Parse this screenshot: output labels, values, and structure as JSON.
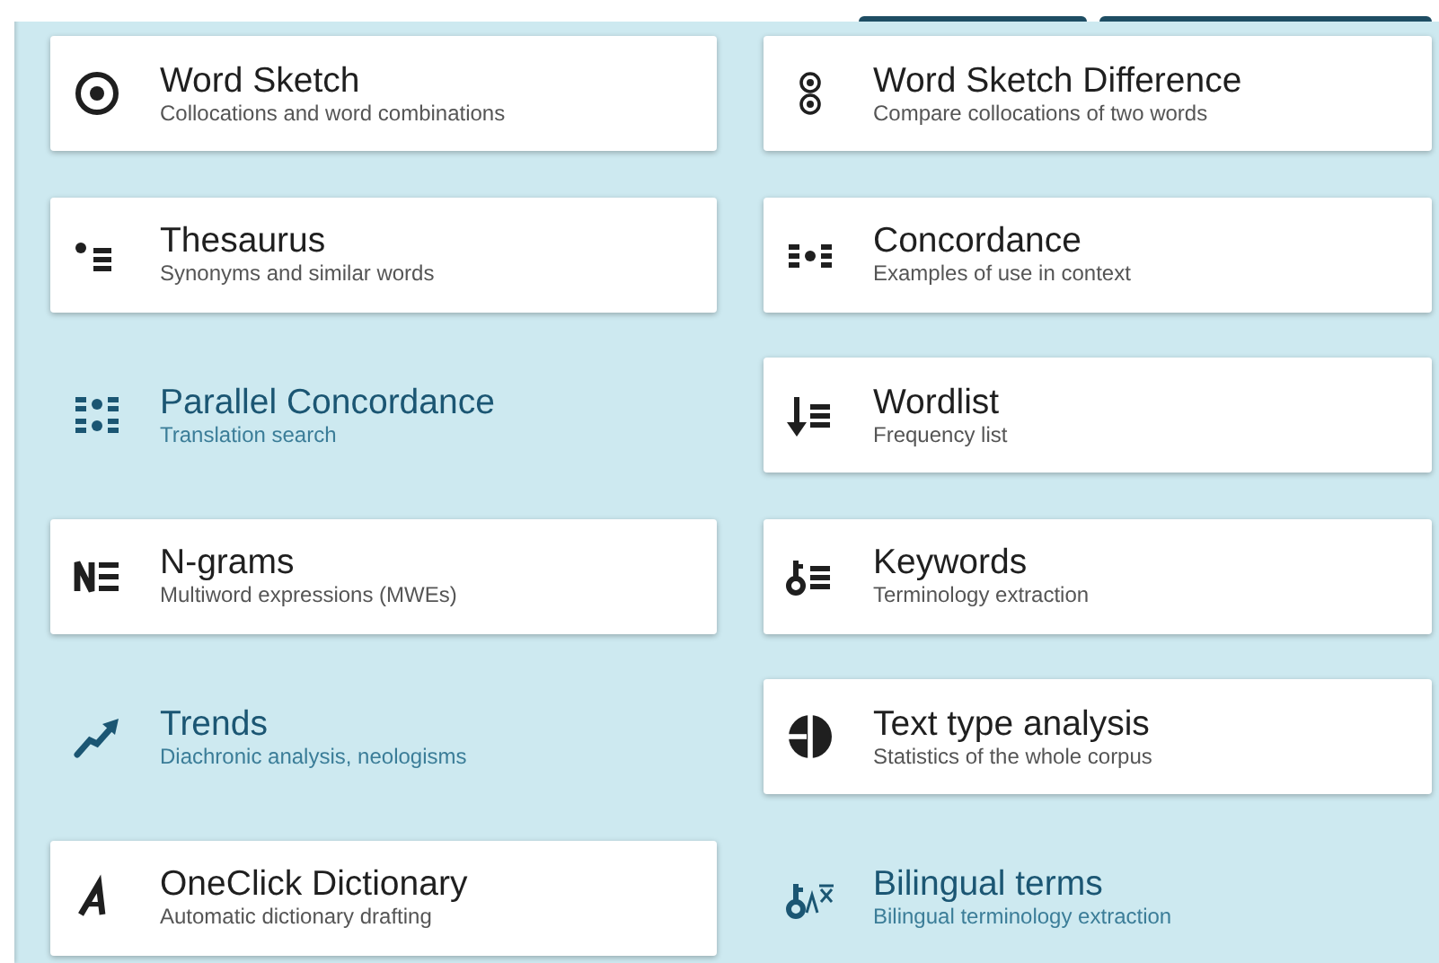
{
  "tools": [
    {
      "title": "Word Sketch",
      "subtitle": "Collocations and word combinations",
      "kind": "card"
    },
    {
      "title": "Word Sketch Difference",
      "subtitle": "Compare collocations of two words",
      "kind": "card"
    },
    {
      "title": "Thesaurus",
      "subtitle": "Synonyms and similar words",
      "kind": "card"
    },
    {
      "title": "Concordance",
      "subtitle": "Examples of use in context",
      "kind": "card"
    },
    {
      "title": "Parallel Concordance",
      "subtitle": "Translation search",
      "kind": "flat"
    },
    {
      "title": "Wordlist",
      "subtitle": "Frequency list",
      "kind": "card"
    },
    {
      "title": "N-grams",
      "subtitle": "Multiword expressions (MWEs)",
      "kind": "card"
    },
    {
      "title": "Keywords",
      "subtitle": "Terminology extraction",
      "kind": "card"
    },
    {
      "title": "Trends",
      "subtitle": "Diachronic analysis, neologisms",
      "kind": "flat"
    },
    {
      "title": "Text type analysis",
      "subtitle": "Statistics of the whole corpus",
      "kind": "card"
    },
    {
      "title": "OneClick Dictionary",
      "subtitle": "Automatic dictionary drafting",
      "kind": "card"
    },
    {
      "title": "Bilingual terms",
      "subtitle": "Bilingual terminology extraction",
      "kind": "flat"
    }
  ]
}
